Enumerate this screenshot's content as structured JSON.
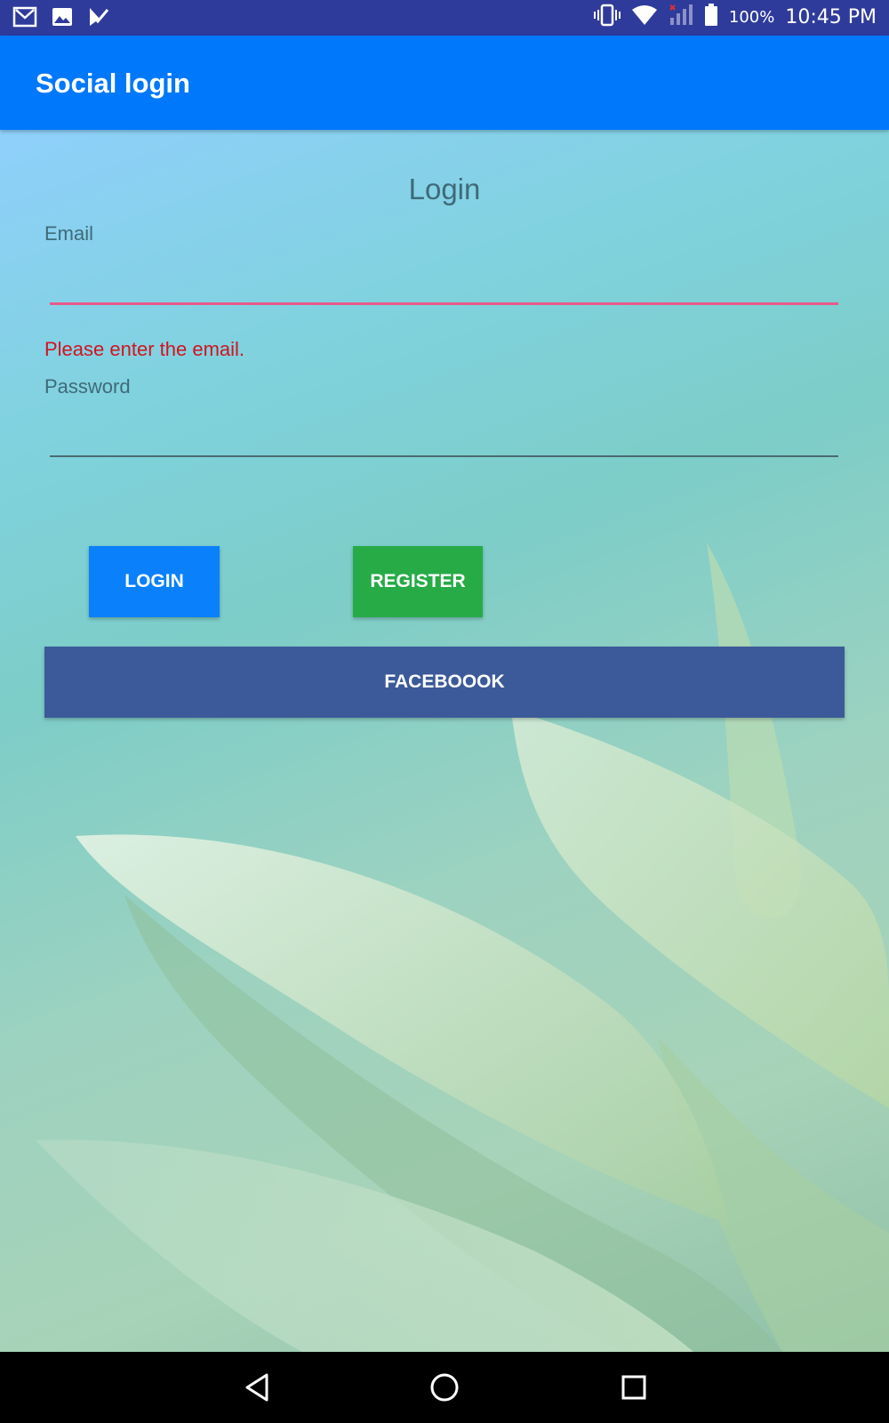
{
  "status_bar": {
    "icons_left": [
      "gmail-icon",
      "gallery-icon",
      "tasks-icon"
    ],
    "icons_right": [
      "vibrate-icon",
      "wifi-icon",
      "signal-icon",
      "battery-icon"
    ],
    "battery_percent": "100%",
    "time": "10:45 PM"
  },
  "app_bar": {
    "title": "Social login",
    "color": "#0078fb"
  },
  "form": {
    "title": "Login",
    "email_label": "Email",
    "email_value": "",
    "email_error": "Please enter the email.",
    "password_label": "Password",
    "password_value": ""
  },
  "buttons": {
    "login": "LOGIN",
    "register": "REGISTER",
    "facebook": "FACEBOOOK"
  },
  "colors": {
    "login": "#0a80fb",
    "register": "#27ab47",
    "facebook": "#3c5a9a",
    "error": "#d2141e",
    "status_bar": "#2f3b9b"
  },
  "nav_bar": {
    "icons": [
      "back-icon",
      "home-icon",
      "recents-icon"
    ]
  }
}
